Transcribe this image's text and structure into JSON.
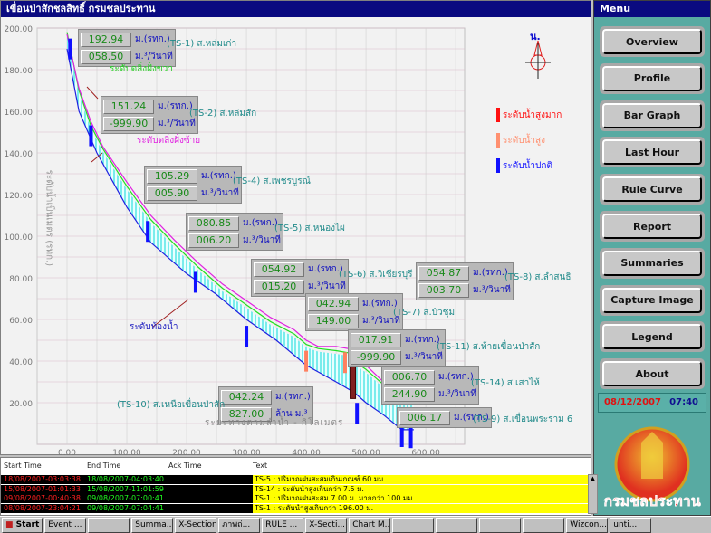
{
  "window": {
    "title": "เขื่อนป่าสักชลสิทธิ์ กรมชลประทาน"
  },
  "chart_data": {
    "type": "line",
    "xlabel": "ระยะทางตามลำน้ำ - กิโลเมตร",
    "ylabel": "ระดับน้ำเป็นเมตร (รทก.)",
    "xlim": [
      -50,
      665
    ],
    "ylim": [
      0,
      200
    ],
    "xticks": [
      "0.00",
      "100.00",
      "200.00",
      "300.00",
      "400.00",
      "500.00",
      "600.00"
    ],
    "yticks": [
      "20.00",
      "40.00",
      "60.00",
      "80.00",
      "100.00",
      "120.00",
      "140.00",
      "160.00",
      "180.00",
      "200.00"
    ],
    "grid": true,
    "series": [
      {
        "name": "ระดับตลิ่งฝั่งขวา",
        "color": "#20e020",
        "x": [
          0,
          20,
          40,
          60,
          100,
          140,
          180,
          220,
          260,
          300,
          340,
          380,
          400,
          420,
          450,
          470,
          480,
          500,
          540,
          560,
          580
        ],
        "y": [
          198,
          170,
          153,
          142,
          124,
          108,
          96,
          85,
          75,
          67,
          59,
          53,
          48,
          46,
          45,
          44,
          40,
          36,
          26,
          20,
          24
        ]
      },
      {
        "name": "ระดับตลิ่งฝั่งซ้าย",
        "color": "#e020e0",
        "x": [
          0,
          20,
          40,
          60,
          100,
          140,
          180,
          220,
          260,
          300,
          340,
          380,
          400,
          420,
          450,
          470,
          480,
          500,
          540,
          560,
          580
        ],
        "y": [
          197,
          171,
          155,
          143,
          126,
          110,
          98,
          87,
          77,
          69,
          61,
          55,
          50,
          47,
          47,
          46,
          42,
          38,
          27,
          21,
          25
        ]
      },
      {
        "name": "ระดับท้องน้ำ",
        "color": "#2020e0",
        "x": [
          0,
          20,
          50,
          100,
          140,
          200,
          250,
          300,
          350,
          400,
          450,
          480,
          500,
          530,
          560,
          580
        ],
        "y": [
          190,
          160,
          140,
          114,
          97,
          82,
          72,
          60,
          50,
          38,
          30,
          25,
          20,
          14,
          7,
          7
        ]
      }
    ],
    "annotations": [
      "ระดับตลิ่งฝั่งขวา",
      "ระดับตลิ่งฝั่งซ้าย",
      "ระดับท้องน้ำ"
    ]
  },
  "stations": [
    {
      "id": "TS-1",
      "name": "(TS-1) ส.หล่มเก่า",
      "level": "192.94",
      "flow": "058.50",
      "unit1": "ม.(รทก.)",
      "unit2": "ม.³/วินาที",
      "km": 5,
      "status": "normal"
    },
    {
      "id": "TS-2",
      "name": "(TS-2) ส.หล่มสัก",
      "level": "151.24",
      "flow": "-999.90",
      "unit1": "ม.(รทก.)",
      "unit2": "ม.³/วินาที",
      "km": 40,
      "status": "normal"
    },
    {
      "id": "TS-4",
      "name": "(TS-4) ส.เพชรบูรณ์",
      "level": "105.29",
      "flow": "005.90",
      "unit1": "ม.(รทก.)",
      "unit2": "ม.³/วินาที",
      "km": 135,
      "status": "normal"
    },
    {
      "id": "TS-5",
      "name": "(TS-5) ส.หนองไผ่",
      "level": "080.85",
      "flow": "006.20",
      "unit1": "ม.(รทก.)",
      "unit2": "ม.³/วินาที",
      "km": 215,
      "status": "normal"
    },
    {
      "id": "TS-6",
      "name": "(TS-6) ส.วิเชียรบุรี",
      "level": "054.92",
      "flow": "015.20",
      "unit1": "ม.(รทก.)",
      "unit2": "ม.³/วินาที",
      "km": 300,
      "status": "normal"
    },
    {
      "id": "TS-8",
      "name": "(TS-8) ส.ลำสนธิ",
      "level": "054.87",
      "flow": "003.70",
      "unit1": "ม.(รทก.)",
      "unit2": "ม.³/วินาที",
      "status": "normal"
    },
    {
      "id": "TS-7",
      "name": "(TS-7) ส.บัวชุม",
      "level": "042.94",
      "flow": "149.00",
      "unit1": "ม.(รทก.)",
      "unit2": "ม.³/วินาที",
      "km": 400,
      "status": "high"
    },
    {
      "id": "TS-11",
      "name": "(TS-11) ส.ท้ายเขื่อนป่าสัก",
      "level": "017.91",
      "flow": "-999.90",
      "unit1": "ม.(รทก.)",
      "unit2": "ม.³/วินาที",
      "km": 485,
      "status": "normal"
    },
    {
      "id": "TS-14",
      "name": "(TS-14) ส.เสาไห้",
      "level": "006.70",
      "flow": "244.90",
      "unit1": "ม.(รทก.)",
      "unit2": "ม.³/วินาที",
      "km": 560,
      "status": "normal"
    },
    {
      "id": "TS-10",
      "name": "(TS-10) ส.เหนือเขื่อนป่าสัก",
      "level": "042.24",
      "flow": "827.00",
      "unit1": "ม.(รทก.)",
      "unit2": "ล้าน ม.³",
      "km": 465,
      "status": "high"
    },
    {
      "id": "TS-9",
      "name": "(TS-9) ส.เขื่อนพระราม 6",
      "level": "006.17",
      "unit1": "ม.(รทก.)",
      "km": 575,
      "status": "normal"
    }
  ],
  "legend": {
    "north": "น.",
    "items": [
      {
        "label": "ระดับน้ำสูงมาก",
        "color": "#ff1010"
      },
      {
        "label": "ระดับน้ำสูง",
        "color": "#ff9070"
      },
      {
        "label": "ระดับน้ำปกติ",
        "color": "#1010ff"
      }
    ]
  },
  "menu": {
    "title": "Menu",
    "buttons": [
      "Overview",
      "Profile",
      "Bar Graph",
      "Last Hour",
      "Rule Curve",
      "Report",
      "Summaries",
      "Capture Image",
      "Legend",
      "About"
    ],
    "date": "08/12/2007",
    "time": "07:40",
    "logo_text": "กรมชลประทาน"
  },
  "alarms": {
    "headers": [
      "Start Time",
      "End Time",
      "Ack Time",
      "Text"
    ],
    "rows": [
      {
        "start": "18/08/2007-03:03:38",
        "end": "18/08/2007-04:03:40",
        "ack": "",
        "text": "TS-5 : ปริมาณฝนสะสมเกินเกณฑ์ 60 มม."
      },
      {
        "start": "15/08/2007-01:01:33",
        "end": "15/08/2007-11:01:59",
        "ack": "",
        "text": "TS-14 : ระดับน้ำสูงเกินกว่า 7.5 ม."
      },
      {
        "start": "09/08/2007-00:40:38",
        "end": "09/08/2007-07:00:41",
        "ack": "",
        "text": "TS-1 : ปริมาณฝนสะสม 7.00 ม. มากกว่า 100 มม."
      },
      {
        "start": "08/08/2007-23:04:21",
        "end": "09/08/2007-07:04:41",
        "ack": "",
        "text": "TS-1 : ระดับน้ำสูงเกินกว่า 196.00 ม."
      }
    ]
  },
  "taskbar": {
    "start": "Start",
    "items": [
      "Event ...",
      "",
      "Summa...",
      "X-Section",
      "ภาพถ่...",
      "RULE ...",
      "X-Secti...",
      "Chart M...",
      "",
      "",
      "",
      "",
      "Wizcon...",
      "unti..."
    ]
  }
}
